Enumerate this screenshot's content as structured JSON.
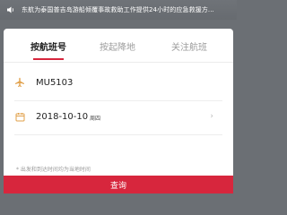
{
  "notice": {
    "icon": "speaker-icon",
    "text": "东航为泰国普吉岛游船倾覆事故救助工作提供24小时的应急救援方..."
  },
  "tabs": [
    {
      "label": "按航班号",
      "active": true
    },
    {
      "label": "按起降地",
      "active": false
    },
    {
      "label": "关注航班",
      "active": false
    }
  ],
  "flight": {
    "icon": "airplane-icon",
    "value": "MU5103"
  },
  "date": {
    "icon": "calendar-icon",
    "value": "2018-10-10",
    "weekday": "周四",
    "chevron": "›"
  },
  "hint": "* 出发和到达时间均为当地时间",
  "query_button": "查询",
  "colors": {
    "accent": "#d7263d",
    "icon": "#e1a04a",
    "overlay": "#6b6f74"
  }
}
